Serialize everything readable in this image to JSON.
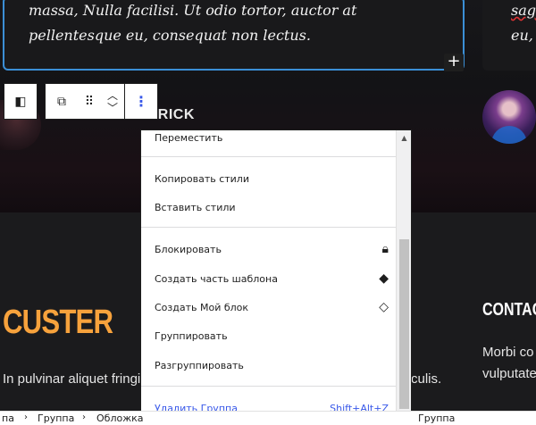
{
  "page": {
    "quote_left": "massa, Nulla facilisi. Ut odio tortor, auctor at pellentesque eu, consequat non lectus.",
    "quote_right_line1": "sag",
    "quote_right_line2": "eu,",
    "author_name": "ALLAN PATRICK",
    "brand_heading": "CUSTER",
    "body_text_left": "In pulvinar aliquet fringi",
    "body_text_mid": "culis.",
    "contact_heading": "CONTACT",
    "contact_text_line1": "Morbi co",
    "contact_text_line2": "vulputate.",
    "add_block_label": "+"
  },
  "toolbar": {
    "parent_icon": "columns-icon",
    "transform_icon": "duplicate-icon",
    "drag_icon": "drag-handle-icon",
    "move_up_icon": "chevron-up-icon",
    "move_down_icon": "chevron-down-icon",
    "more_icon": "vertical-ellipsis-icon",
    "glyph_parent": "◧",
    "glyph_transform": "⧉",
    "glyph_drag": "⠿",
    "glyph_up": "︿",
    "glyph_down": "﹀",
    "glyph_more": "⋮"
  },
  "menu": {
    "items": [
      {
        "label": "Переместить"
      },
      {
        "label": "Копировать стили"
      },
      {
        "label": "Вставить стили"
      },
      {
        "label": "Блокировать",
        "icon": "lock-icon",
        "glyph": "🔒︎"
      },
      {
        "label": "Создать часть шаблона",
        "icon": "template-part-icon",
        "glyph": "◆"
      },
      {
        "label": "Создать Мой блок",
        "icon": "reusable-block-icon",
        "glyph": "◇"
      },
      {
        "label": "Группировать"
      },
      {
        "label": "Разгруппировать"
      },
      {
        "label": "Удалить Группа",
        "shortcut": "Shift+Alt+Z"
      }
    ],
    "scroll_up_glyph": "▲",
    "scroll_down_glyph": "▼"
  },
  "breadcrumb": {
    "items": [
      "па",
      "Группа",
      "Обложка",
      "Группа"
    ],
    "separator": "›"
  },
  "colors": {
    "accent": "#3858e9",
    "brand_orange": "#f7a23c",
    "selection_border": "#3b8fd6"
  }
}
